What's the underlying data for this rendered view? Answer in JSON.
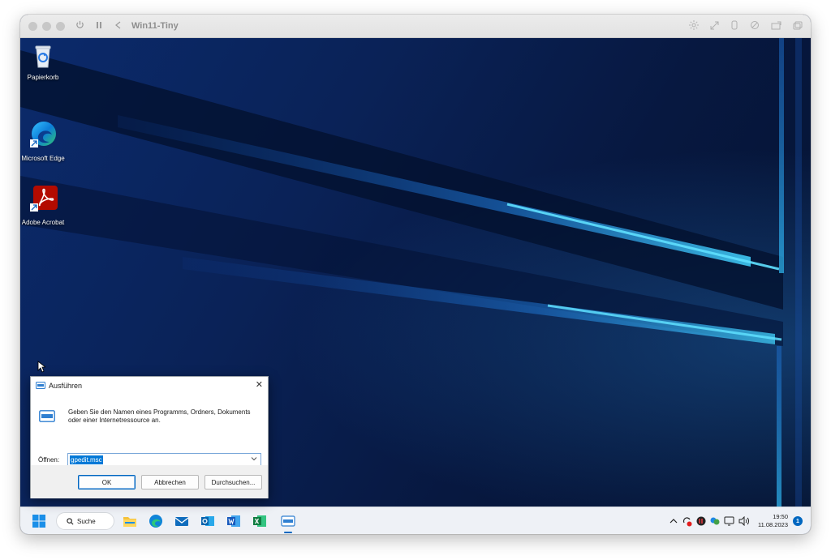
{
  "vm": {
    "title": "Win11-Tiny"
  },
  "desktop": {
    "icons": [
      {
        "label": "Papierkorb"
      },
      {
        "label": "Microsoft Edge"
      },
      {
        "label": "Adobe Acrobat"
      }
    ]
  },
  "run_dialog": {
    "title": "Ausführen",
    "close_glyph": "✕",
    "description": "Geben Sie den Namen eines Programms, Ordners, Dokuments oder einer Internetressource an.",
    "open_label": "Öffnen:",
    "open_value": "gpedit.msc",
    "ok_label": "OK",
    "cancel_label": "Abbrechen",
    "browse_label": "Durchsuchen..."
  },
  "taskbar": {
    "search_label": "Suche",
    "pinned": [
      "start-icon",
      "file-explorer-icon",
      "edge-icon",
      "mail-icon",
      "outlook-icon",
      "word-icon",
      "excel-icon",
      "run-app-icon"
    ],
    "tray_chevron": "^",
    "time": "19:50",
    "date": "11.08.2023",
    "notification_count": "1"
  },
  "colors": {
    "accent": "#0067c0",
    "wallpaper_dark": "#051230",
    "wallpaper_light": "#2fb7f0"
  }
}
